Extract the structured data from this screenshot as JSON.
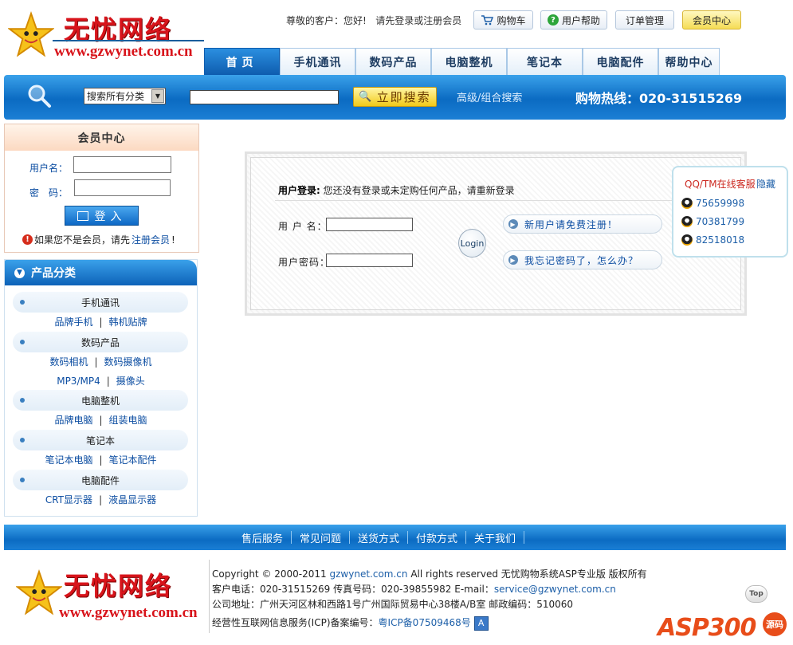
{
  "header": {
    "logo_text": "无忧网络",
    "logo_url": "www.gzwynet.com.cn",
    "greeting_prefix": "尊敬的客户：您好!",
    "greeting_login": "请先登录",
    "greeting_or": "或",
    "greeting_register": "注册会员",
    "cart_label": "购物车",
    "help_label": "用户帮助",
    "orders_label": "订单管理",
    "member_center_label": "会员中心"
  },
  "nav": {
    "tabs": [
      {
        "label": "首页"
      },
      {
        "label": "手机通讯"
      },
      {
        "label": "数码产品"
      },
      {
        "label": "电脑整机"
      },
      {
        "label": "笔记本"
      },
      {
        "label": "电脑配件"
      },
      {
        "label": "帮助中心"
      }
    ],
    "active_index": 0
  },
  "search": {
    "category_selected": "搜索所有分类",
    "keyword_value": "",
    "button_label": "立即搜索",
    "advanced_label": "高级/组合搜索",
    "hotline": "购物热线：020-31515269"
  },
  "member": {
    "title": "会员中心",
    "username_label": "用户名：",
    "password_label": "密　码：",
    "login_label": "登入",
    "notice_prefix": "如果您不是会员，请先",
    "notice_link": "注册会员",
    "notice_suffix": "!"
  },
  "categories": {
    "title": "产品分类",
    "groups": [
      {
        "name": "手机通讯",
        "subs": [
          "品牌手机",
          "韩机贴牌"
        ]
      },
      {
        "name": "数码产品",
        "subs": [
          "数码相机",
          "数码摄像机",
          "MP3/MP4",
          "摄像头"
        ]
      },
      {
        "name": "电脑整机",
        "subs": [
          "品牌电脑",
          "组装电脑"
        ]
      },
      {
        "name": "笔记本",
        "subs": [
          "笔记本电脑",
          "笔记本配件"
        ]
      },
      {
        "name": "电脑配件",
        "subs": [
          "CRT显示器",
          "液晶显示器"
        ]
      }
    ]
  },
  "login_panel": {
    "title_bold": "用户登录:",
    "title_text": "您还没有登录或未定购任何产品，请重新登录",
    "username_label": "用 户 名：",
    "password_label": "用户密码：",
    "login_button": "Login",
    "register_link": "新用户请免费注册！",
    "forgot_link": "我忘记密码了，怎么办？"
  },
  "qq": {
    "title": "QQ/TM在线客服",
    "hide_label": "隐藏",
    "numbers": [
      "75659998",
      "70381799",
      "82518018"
    ]
  },
  "footer": {
    "links": [
      "售后服务",
      "常见问题",
      "送货方式",
      "付款方式",
      "关于我们"
    ],
    "copyright_prefix": "Copyright © 2000-2011 ",
    "copyright_domain": "gzwynet.com.cn",
    "copyright_suffix": " All rights reserved 无忧购物系统ASP专业版 版权所有",
    "phone_line_prefix": "客户电话：020-31515269 传真号码：020-39855982 E-mail：",
    "email": "service@gzwynet.com.cn",
    "address": "公司地址：广州天河区林和西路1号广州国际贸易中心38楼A/B室  邮政编码：510060",
    "icp_prefix": "经营性互联网信息服务(ICP)备案编号：",
    "icp_number": "粤ICP备07509468号",
    "top_label": "Top",
    "watermark_text": "ASP300",
    "watermark_mark": "源码"
  },
  "colors": {
    "brand_blue": "#0b6bc2",
    "brand_red": "#d8141b",
    "link_blue": "#0d4ea2"
  }
}
